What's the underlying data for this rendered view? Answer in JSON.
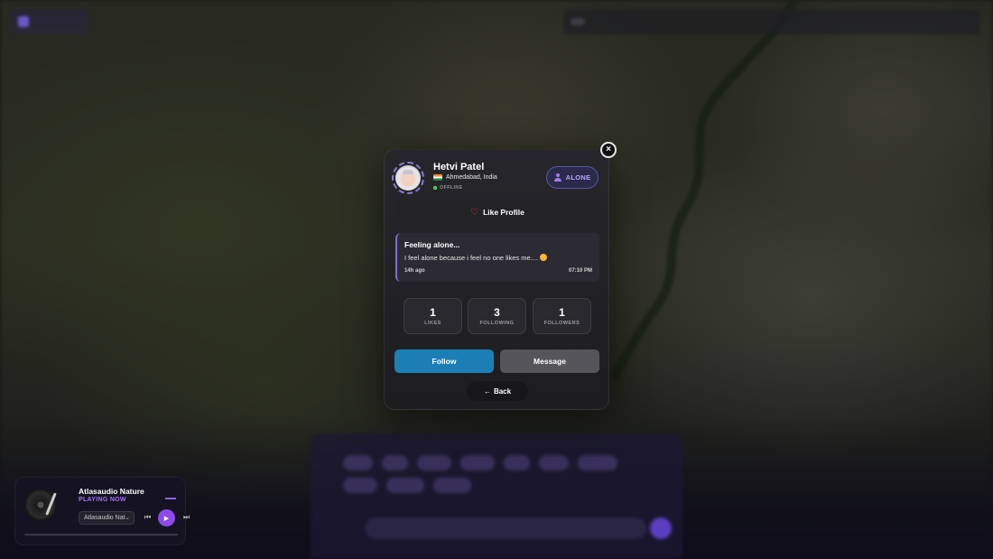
{
  "topbar": {
    "left_title": "",
    "nav_items": [
      "",
      "",
      "",
      "",
      "",
      ""
    ]
  },
  "profile": {
    "name": "Hetvi Patel",
    "location": "Ahmedabad, India",
    "status": "OFFLINE",
    "mood": "ALONE",
    "like_label": "Like Profile",
    "post": {
      "title": "Feeling alone...",
      "body": "I feel alone because i feel no one likes me....",
      "age": "14h ago",
      "time": "07:10 PM"
    },
    "stats": [
      {
        "value": "1",
        "label": "LIKES"
      },
      {
        "value": "3",
        "label": "FOLLOWING"
      },
      {
        "value": "1",
        "label": "FOLLOWERS"
      }
    ],
    "follow_label": "Follow",
    "message_label": "Message",
    "back_label": "Back",
    "close_label": "×"
  },
  "player": {
    "title": "Atlasaudio Nature",
    "status": "PLAYING NOW",
    "selected_station": "Atlasaudio Nat",
    "progress": 0.0
  },
  "colors": {
    "accent": "#8c4be8",
    "follow": "#1b7fb6",
    "mood": "#b7a8ff",
    "heart": "#e5445a"
  }
}
